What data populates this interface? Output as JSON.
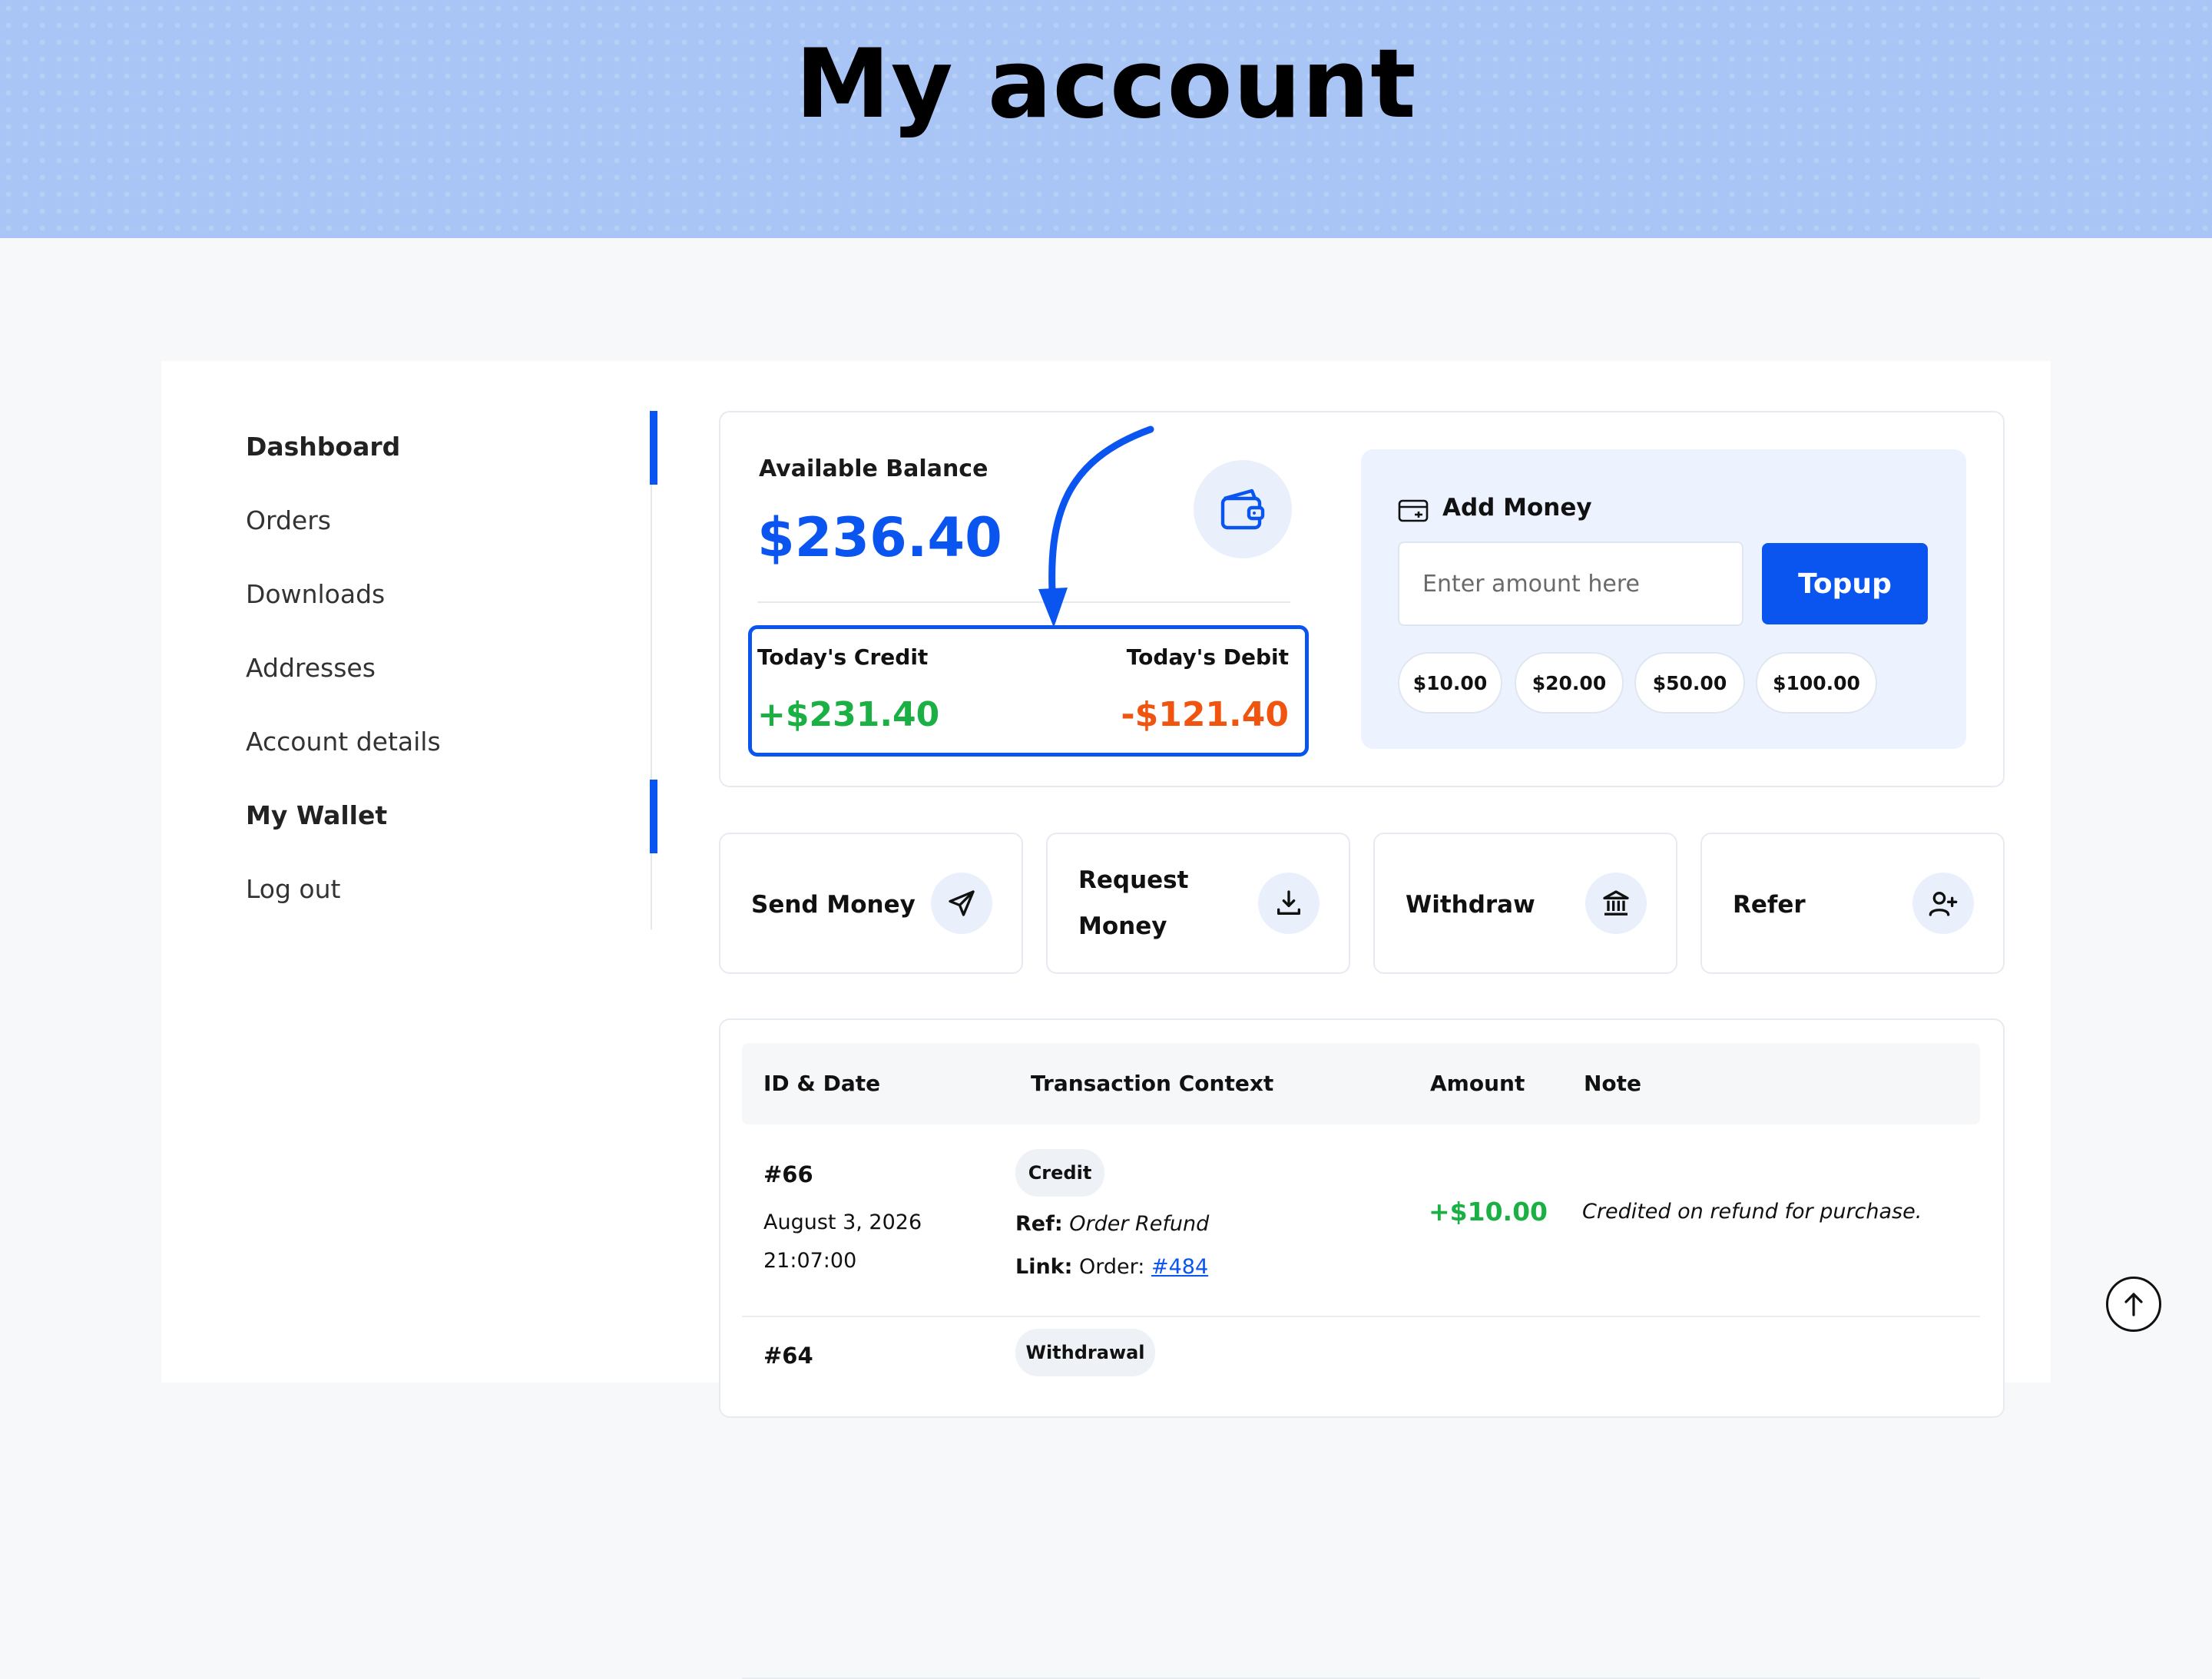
{
  "page_title": "My account",
  "sidebar": {
    "items": [
      {
        "label": "Dashboard",
        "active": true
      },
      {
        "label": "Orders",
        "active": false
      },
      {
        "label": "Downloads",
        "active": false
      },
      {
        "label": "Addresses",
        "active": false
      },
      {
        "label": "Account details",
        "active": false
      },
      {
        "label": "My Wallet",
        "active": true
      },
      {
        "label": "Log out",
        "active": false
      }
    ]
  },
  "balance": {
    "label": "Available Balance",
    "amount": "$236.40",
    "icon": "wallet-icon",
    "credit_label": "Today's Credit",
    "credit_value": "+$231.40",
    "debit_label": "Today's Debit",
    "debit_value": "-$121.40"
  },
  "add_money": {
    "title": "Add Money",
    "icon": "card-icon",
    "input_placeholder": "Enter amount here",
    "input_value": "",
    "button_label": "Topup",
    "presets": [
      "$10.00",
      "$20.00",
      "$50.00",
      "$100.00"
    ]
  },
  "actions": [
    {
      "label": "Send Money",
      "icon": "send-icon"
    },
    {
      "label": "Request Money",
      "icon": "download-icon"
    },
    {
      "label": "Withdraw",
      "icon": "bank-icon"
    },
    {
      "label": "Refer",
      "icon": "add-user-icon"
    }
  ],
  "table": {
    "headers": [
      "ID & Date",
      "Transaction Context",
      "Amount",
      "Note"
    ],
    "rows": [
      {
        "id": "#66",
        "date": "August 3, 2026",
        "time": "21:07:00",
        "type": "Credit",
        "ref_label": "Ref:",
        "ref_value": "Order Refund",
        "link_label": "Link:",
        "link_prefix": "Order:",
        "link_value": "#484",
        "amount": "+$10.00",
        "note": "Credited on refund for purchase."
      },
      {
        "id": "#64",
        "type": "Withdrawal"
      }
    ]
  },
  "colors": {
    "accent": "#0a55f0",
    "credit": "#1bb043",
    "debit": "#f0540f",
    "hero": "#a9c5f5"
  }
}
